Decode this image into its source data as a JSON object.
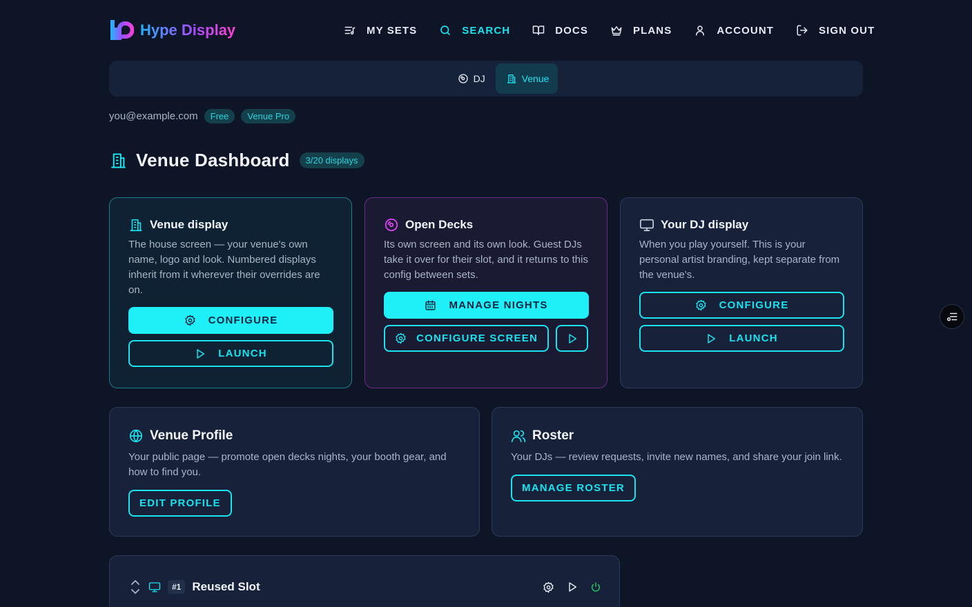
{
  "brand": {
    "name": "Hype Display"
  },
  "nav": {
    "items": [
      {
        "label": "MY SETS",
        "icon": "list-music-icon"
      },
      {
        "label": "SEARCH",
        "icon": "search-icon",
        "active": true
      },
      {
        "label": "DOCS",
        "icon": "book-icon"
      },
      {
        "label": "PLANS",
        "icon": "crown-icon"
      },
      {
        "label": "ACCOUNT",
        "icon": "user-icon"
      },
      {
        "label": "SIGN OUT",
        "icon": "sign-out-icon"
      }
    ]
  },
  "mode": {
    "dj_label": "DJ",
    "venue_label": "Venue",
    "active": "Venue"
  },
  "account": {
    "email": "you@example.com",
    "plan_badge": "Free",
    "tier_badge": "Venue Pro"
  },
  "page": {
    "title": "Venue Dashboard",
    "display_count": "3/20 displays"
  },
  "cards": {
    "venue": {
      "title": "Venue display",
      "description": "The house screen — your venue's own name, logo and look. Numbered displays inherit from it wherever their overrides are on.",
      "configure_label": "CONFIGURE",
      "launch_label": "LAUNCH"
    },
    "decks": {
      "title": "Open Decks",
      "description": "Its own screen and its own look. Guest DJs take it over for their slot, and it returns to this config between sets.",
      "manage_label": "MANAGE NIGHTS",
      "configure_label": "CONFIGURE SCREEN"
    },
    "dj": {
      "title": "Your DJ display",
      "description": "When you play yourself. This is your personal artist branding, kept separate from the venue's.",
      "configure_label": "CONFIGURE",
      "launch_label": "LAUNCH"
    },
    "profile": {
      "title": "Venue Profile",
      "description": "Your public page — promote open decks nights, your booth gear, and how to find you.",
      "button_label": "EDIT PROFILE"
    },
    "roster": {
      "title": "Roster",
      "description": "Your DJs — review requests, invite new names, and share your join link.",
      "button_label": "MANAGE ROSTER"
    }
  },
  "slot": {
    "number": "#1",
    "name": "Reused Slot"
  },
  "colors": {
    "accent": "#19e3ef",
    "background": "#0d1526",
    "card": "#17223a",
    "power_on": "#22c55e",
    "decks_border": "#6a2b86"
  }
}
